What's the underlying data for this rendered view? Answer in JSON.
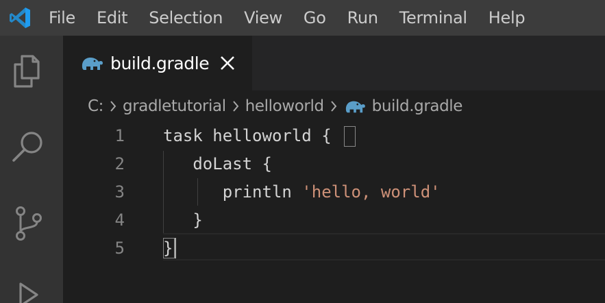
{
  "menu": {
    "items": [
      "File",
      "Edit",
      "Selection",
      "View",
      "Go",
      "Run",
      "Terminal",
      "Help"
    ]
  },
  "activity_bar": {
    "icons": [
      "explorer-icon",
      "search-icon",
      "source-control-icon",
      "run-debug-icon"
    ]
  },
  "tab": {
    "label": "build.gradle",
    "icon": "gradle-elephant-icon",
    "close_icon": "close-icon"
  },
  "breadcrumb": {
    "items": [
      "C:",
      "gradletutorial",
      "helloworld",
      "build.gradle"
    ]
  },
  "editor": {
    "line_numbers": [
      "1",
      "2",
      "3",
      "4",
      "5"
    ],
    "lines": [
      {
        "text": "task helloworld {"
      },
      {
        "text": "   doLast {"
      },
      {
        "prefix": "      println ",
        "string": "'hello, world'"
      },
      {
        "text": "   }"
      },
      {
        "text": "}"
      }
    ]
  },
  "colors": {
    "titlebar": "#3c3c3c",
    "activitybar": "#333333",
    "editor_bg": "#1e1e1e",
    "tabbar_bg": "#252526",
    "accent_blue": "#0078d4",
    "gradle_icon": "#5a9ec9",
    "string": "#ce9178",
    "text": "#d4d4d4",
    "line_number": "#858585"
  }
}
